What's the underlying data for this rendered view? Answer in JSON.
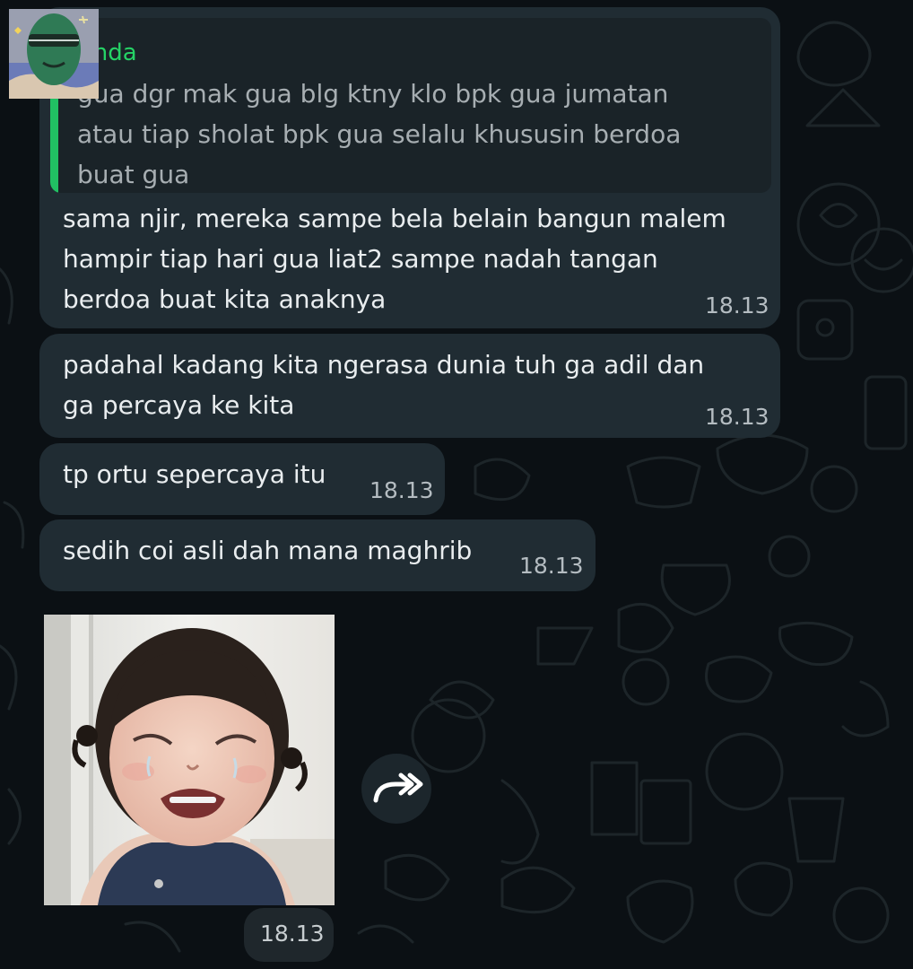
{
  "theme": {
    "background": "#0b1014",
    "bubble": "#202c33",
    "quote_accent": "#21c063",
    "text": "#e9edef",
    "meta_text": "#b4bcc1"
  },
  "quoted_message": {
    "author": "Anda",
    "text": "gua dgr mak gua blg ktny klo bpk gua jumatan\natau tiap sholat bpk gua selalu khususin berdoa\nbuat gua"
  },
  "messages": [
    {
      "text": "sama njir, mereka sampe bela belain bangun malem\nhampir tiap hari gua liat2 sampe nadah tangan\nberdoa buat kita anaknya",
      "time": "18.13"
    },
    {
      "text": "padahal kadang kita ngerasa dunia tuh ga adil dan\nga percaya ke kita",
      "time": "18.13"
    },
    {
      "text": "tp ortu sepercaya itu",
      "time": "18.13"
    },
    {
      "text": "sedih coi asli dah mana maghrib",
      "time": "18.13"
    }
  ],
  "image_message": {
    "time": "18.13",
    "action_icon": "forward-icon"
  }
}
